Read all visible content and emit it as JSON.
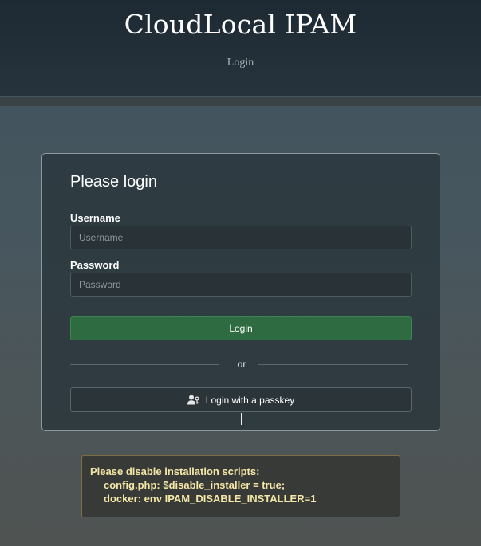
{
  "header": {
    "title": "CloudLocal IPAM",
    "subtitle": "Login"
  },
  "login_form": {
    "heading": "Please login",
    "username_label": "Username",
    "username_placeholder": "Username",
    "username_value": "",
    "password_label": "Password",
    "password_placeholder": "Password",
    "password_value": "",
    "login_button": "Login",
    "separator_text": "or",
    "passkey_button": "Login with a passkey",
    "passkey_icon": "user-key-icon"
  },
  "warning": {
    "title": "Please disable installation scripts:",
    "line1": "config.php: $disable_installer = true;",
    "line2": "docker: env IPAM_DISABLE_INSTALLER=1"
  },
  "colors": {
    "login_button": "#2e6b40",
    "warning_text": "#f4e7a7",
    "header_bg": "#1e2a33"
  }
}
